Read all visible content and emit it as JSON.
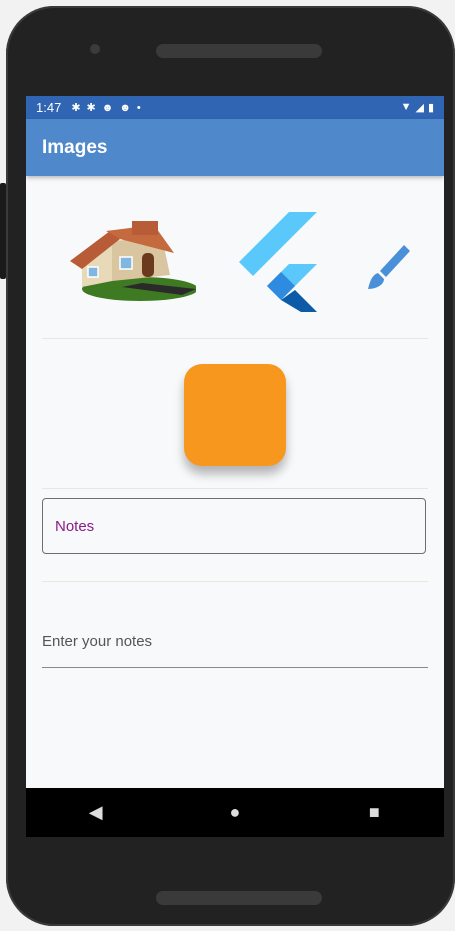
{
  "status_bar": {
    "time": "1:47",
    "left_icons": [
      "settings-icon",
      "settings-icon",
      "android-icon",
      "android-icon",
      "dot-icon"
    ],
    "right_icons": [
      "wifi-icon",
      "signal-icon",
      "battery-icon"
    ]
  },
  "app_bar": {
    "title": "Images"
  },
  "images_row": {
    "items": [
      "house-icon",
      "flutter-logo-icon",
      "paint-brush-icon"
    ]
  },
  "orange_box": {
    "color": "#f7971e"
  },
  "notes_field": {
    "label": "Notes"
  },
  "notes_input": {
    "placeholder": "Enter your notes"
  },
  "nav_bar": {
    "buttons": [
      "back-icon",
      "home-icon",
      "recents-icon"
    ]
  },
  "colors": {
    "status_bar": "#2f65b3",
    "app_bar": "#5088cc",
    "label_accent": "#8b1b88"
  }
}
